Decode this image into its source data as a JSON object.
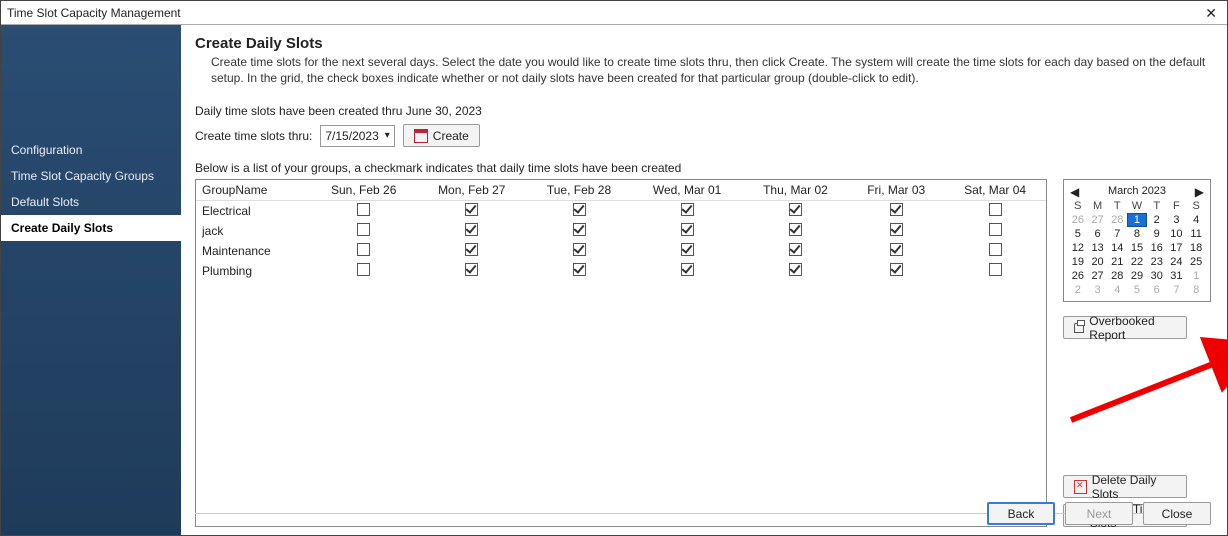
{
  "window": {
    "title": "Time Slot Capacity Management"
  },
  "sidebar": {
    "items": [
      {
        "label": "Configuration",
        "active": false
      },
      {
        "label": "Time Slot Capacity Groups",
        "active": false
      },
      {
        "label": "Default Slots",
        "active": false
      },
      {
        "label": "Create Daily Slots",
        "active": true
      }
    ]
  },
  "page": {
    "title": "Create Daily Slots",
    "description": "Create time slots for the next several days. Select the date you would like to create time slots thru, then click Create. The system will create the time slots for each day based on the default setup. In the grid, the check boxes indicate whether or not daily slots have been created for that particular group (double-click to edit).",
    "status": "Daily time slots have been created thru June 30, 2023",
    "create_label": "Create time slots thru:",
    "date_value": "7/15/2023",
    "create_button": "Create",
    "below_text": "Below is a list of your groups, a checkmark indicates that daily time slots have been created"
  },
  "grid": {
    "columns": [
      "GroupName",
      "Sun, Feb 26",
      "Mon, Feb 27",
      "Tue, Feb 28",
      "Wed, Mar 01",
      "Thu, Mar 02",
      "Fri, Mar 03",
      "Sat, Mar 04"
    ],
    "rows": [
      {
        "name": "Electrical",
        "checks": [
          false,
          true,
          true,
          true,
          true,
          true,
          false
        ]
      },
      {
        "name": "jack",
        "checks": [
          false,
          true,
          true,
          true,
          true,
          true,
          false
        ]
      },
      {
        "name": "Maintenance",
        "checks": [
          false,
          true,
          true,
          true,
          true,
          true,
          false
        ]
      },
      {
        "name": "Plumbing",
        "checks": [
          false,
          true,
          true,
          true,
          true,
          true,
          false
        ]
      }
    ]
  },
  "calendar": {
    "month_label": "March 2023",
    "dow": [
      "S",
      "M",
      "T",
      "W",
      "T",
      "F",
      "S"
    ],
    "lead_off": [
      26,
      27,
      28
    ],
    "days": 31,
    "selected": 1,
    "trail_off": [
      1,
      2,
      3,
      4,
      5,
      6,
      7,
      8
    ]
  },
  "buttons": {
    "overbooked": "Overbooked Report",
    "delete": "Delete Daily Slots",
    "disable": "Disable Time Slots",
    "back": "Back",
    "next": "Next",
    "close": "Close"
  }
}
